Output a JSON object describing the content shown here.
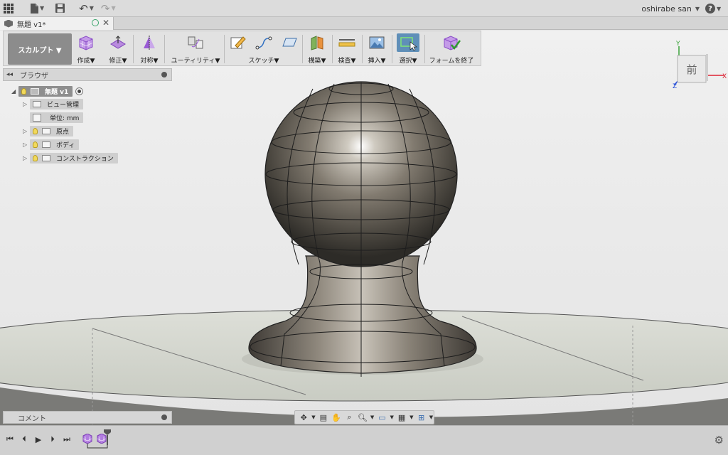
{
  "topbar": {
    "user_name": "oshirabe san"
  },
  "document_tab": {
    "title": "無題 v1*"
  },
  "ribbon": {
    "workspace_label": "スカルプト ▼",
    "tools": [
      {
        "label": "作成▼"
      },
      {
        "label": "修正▼"
      },
      {
        "label": "対称▼"
      },
      {
        "label": "ユーティリティ▼"
      },
      {
        "label": "スケッチ▼"
      },
      {
        "label": "構築▼"
      },
      {
        "label": "検査▼"
      },
      {
        "label": "挿入▼"
      },
      {
        "label": "選択▼"
      },
      {
        "label": "フォームを終了"
      }
    ]
  },
  "browser": {
    "title": "ブラウザ",
    "items": [
      {
        "label": "無題 v1"
      },
      {
        "label": "ビュー管理"
      },
      {
        "label": "単位: mm"
      },
      {
        "label": "原点"
      },
      {
        "label": "ボディ"
      },
      {
        "label": "コンストラクション"
      }
    ]
  },
  "viewcube": {
    "face_label": "前",
    "axis_x": "X",
    "axis_y": "Y",
    "axis_z": "Z"
  },
  "comments": {
    "title": "コメント"
  },
  "colors": {
    "accent_blue": "#5f8fb8",
    "form_purple": "#9a5bd6",
    "body_gray": "#6f6a62"
  }
}
